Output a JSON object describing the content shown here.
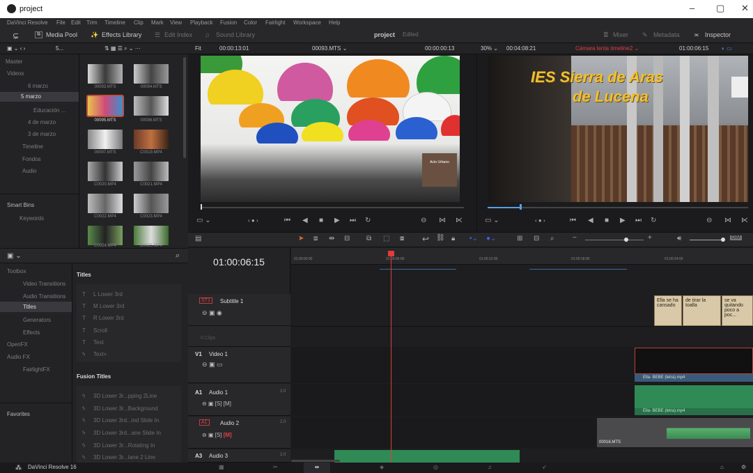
{
  "window": {
    "title": "project",
    "minimize": "–",
    "maximize": "▢",
    "close": "✕"
  },
  "menu": [
    "DaVinci Resolve",
    "File",
    "Edit",
    "Trim",
    "Timeline",
    "Clip",
    "Mark",
    "View",
    "Playback",
    "Fusion",
    "Color",
    "Fairlight",
    "Workspace",
    "Help"
  ],
  "toolbar": {
    "media_pool": "Media Pool",
    "effects_library": "Effects Library",
    "edit_index": "Edit Index",
    "sound_library": "Sound Library",
    "project_name": "project",
    "project_state": "Edited",
    "mixer": "Mixer",
    "metadata": "Metadata",
    "inspector": "Inspector"
  },
  "subbar": {
    "pool_count": "5...",
    "fit": "Fit",
    "source_tc": "00:00:13:01",
    "source_clip": "00093.MTS ⌄",
    "source_dur": "00:00:00:13",
    "zoom": "30% ⌄",
    "tl_dur": "00:04:08:21",
    "timeline_name": "Cámara lenta timeline2 ⌄",
    "record_tc": "01:00:06:15"
  },
  "bins": [
    "Master",
    "Videos",
    "6 marzo",
    "5 marzo",
    "Educación ...",
    "4 de marzo",
    "3 de marzo",
    "Timeline",
    "Fondos",
    "Audio"
  ],
  "smart_bins": {
    "title": "Smart Bins",
    "keywords": "Keywords"
  },
  "clips": [
    "00093.MTS",
    "00094.MTS",
    "00095.MTS",
    "00096.MTS",
    "00097.MTS",
    "C0019.MP4",
    "C0020.MP4",
    "C0021.MP4",
    "C0022.MP4",
    "C0023.MP4",
    "C0024.MP4",
    "C0025.MP4"
  ],
  "toolbox": [
    "Toolbox",
    "Video Transitions",
    "Audio Transitions",
    "Titles",
    "Generators",
    "Effects",
    "OpenFX",
    "Audio FX",
    "FairlightFX"
  ],
  "favorites": "Favorites",
  "titles": {
    "header": "Titles",
    "items": [
      "L Lower 3rd",
      "M Lower 3rd",
      "R Lower 3rd",
      "Scroll",
      "Text",
      "Text+"
    ]
  },
  "fusion_titles": {
    "header": "Fusion Titles",
    "items": [
      "3D Lower 3r...pping 2Line",
      "3D Lower 3r...Background",
      "3D Lower 3rd...ind Slide In",
      "3D Lower 3rd...ane Slide In",
      "3D Lower 3r...Rotating In",
      "3D Lower 3r...lane 2 Line"
    ]
  },
  "viewer_text": {
    "line1": "IES Sierra de Aras",
    "line2": "de Lucena",
    "sign": "Acto Urbano"
  },
  "timeline": {
    "timecode": "01:00:06:15",
    "ruler": [
      "01:00:00:00",
      "01:00:06:00",
      "01:00:12:00",
      "01:00:18:00",
      "01:00:24:00"
    ],
    "tracks": [
      {
        "id": "ST1",
        "name": "Subtitle 1",
        "sub": "0 Clips"
      },
      {
        "id": "V1",
        "name": "Video 1",
        "sub": ""
      },
      {
        "id": "A1",
        "name": "Audio 1",
        "gain": "2.0"
      },
      {
        "id": "A1",
        "name": "Audio 2",
        "gain": "2.0"
      },
      {
        "id": "A3",
        "name": "Audio 3",
        "gain": "2.0"
      }
    ],
    "subtitles": [
      "Ella se ha cansado",
      "de tirar la toalla",
      "se va quitando poco a poc..."
    ],
    "clip_video": "Ella- BEBE (letra).mp4",
    "clip_audio": "Ella- BEBE (letra).mp4",
    "clip_audio2": "00016.MTS"
  },
  "app_footer": "DaVinci Resolve 16",
  "colors": {
    "accent_red": "#e04040",
    "subtitle_clip": "#d9c9a8",
    "audio_clip": "#2f8a55",
    "playhead": "#e23b3b"
  }
}
